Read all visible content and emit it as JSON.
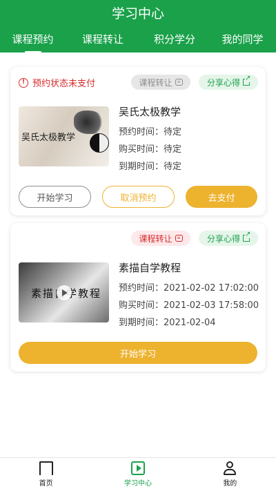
{
  "header": {
    "title": "学习中心",
    "tabs": [
      {
        "label": "课程预约",
        "active": true
      },
      {
        "label": "课程转让",
        "active": false
      },
      {
        "label": "积分学分",
        "active": false
      },
      {
        "label": "我的同学",
        "active": false
      }
    ]
  },
  "colors": {
    "brand_green": "#1aa14a",
    "accent_yellow": "#edb22e",
    "alert_red": "#d62b2b"
  },
  "cards": [
    {
      "status_text": "预约状态未支付",
      "transfer_label": "课程转让",
      "share_label": "分享心得",
      "thumbnail_text": "吴氏太极教学",
      "course_name": "吴氏太极教学",
      "appointment": "预约时间：待定",
      "purchase": "购买时间：待定",
      "expire": "到期时间：待定",
      "btn_start": "开始学习",
      "btn_cancel": "取消预约",
      "btn_pay": "去支付"
    },
    {
      "transfer_label": "课程转让",
      "share_label": "分享心得",
      "thumbnail_text": "素描自学教程",
      "course_name": "素描自学教程",
      "appointment": "预约时间：2021-02-02 17:02:00",
      "purchase": "购买时间：2021-02-03 17:58:00",
      "expire": "到期时间：2021-02-04",
      "btn_start": "开始学习"
    }
  ],
  "bottom_nav": [
    {
      "label": "首页",
      "icon": "bookmark-icon",
      "active": false
    },
    {
      "label": "学习中心",
      "icon": "play-video-icon",
      "active": true
    },
    {
      "label": "我的",
      "icon": "user-icon",
      "active": false
    }
  ]
}
